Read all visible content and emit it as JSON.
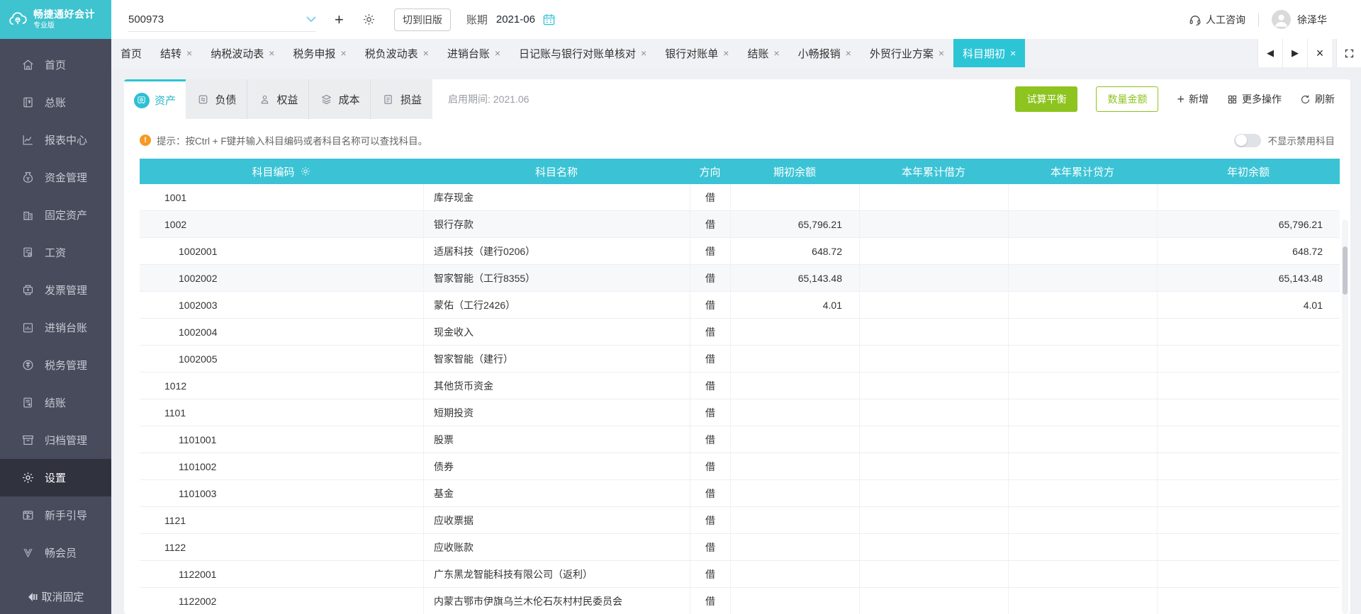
{
  "colors": {
    "brand_teal": "#3ec3cf",
    "active_tab_teal": "#2cc5d6",
    "table_header_teal": "#3bc3d5",
    "action_green": "#8dc41f",
    "sidebar_bg": "#474b5c",
    "sidebar_active_bg": "#30333e",
    "tip_orange": "#f59a23"
  },
  "brand": {
    "name": "畅捷通好会计",
    "edition": "专业版"
  },
  "topbar": {
    "account_number": "500973",
    "switch_old_version": "切到旧版",
    "period_label": "账期",
    "period_value": "2021-06",
    "support_label": "人工咨询",
    "user_name": "徐泽华"
  },
  "tab_strip": {
    "tabs": [
      {
        "label": "首页",
        "closable": false,
        "active": false
      },
      {
        "label": "结转",
        "closable": true,
        "active": false
      },
      {
        "label": "纳税波动表",
        "closable": true,
        "active": false
      },
      {
        "label": "税务申报",
        "closable": true,
        "active": false
      },
      {
        "label": "税负波动表",
        "closable": true,
        "active": false
      },
      {
        "label": "进销台账",
        "closable": true,
        "active": false
      },
      {
        "label": "日记账与银行对账单核对",
        "closable": true,
        "active": false
      },
      {
        "label": "银行对账单",
        "closable": true,
        "active": false
      },
      {
        "label": "结账",
        "closable": true,
        "active": false
      },
      {
        "label": "小畅报销",
        "closable": true,
        "active": false
      },
      {
        "label": "外贸行业方案",
        "closable": true,
        "active": false
      },
      {
        "label": "科目期初",
        "closable": true,
        "active": true
      }
    ]
  },
  "sidebar": {
    "items": [
      {
        "label": "首页",
        "icon": "home-icon",
        "active": false
      },
      {
        "label": "总账",
        "icon": "ledger-icon",
        "active": false
      },
      {
        "label": "报表中心",
        "icon": "report-icon",
        "active": false
      },
      {
        "label": "资金管理",
        "icon": "funds-icon",
        "active": false
      },
      {
        "label": "固定资产",
        "icon": "fixed-asset-icon",
        "active": false
      },
      {
        "label": "工资",
        "icon": "salary-icon",
        "active": false
      },
      {
        "label": "发票管理",
        "icon": "invoice-icon",
        "active": false
      },
      {
        "label": "进销台账",
        "icon": "inventory-icon",
        "active": false
      },
      {
        "label": "税务管理",
        "icon": "tax-icon",
        "active": false
      },
      {
        "label": "结账",
        "icon": "closing-icon",
        "active": false
      },
      {
        "label": "归档管理",
        "icon": "archive-icon",
        "active": false
      },
      {
        "label": "设置",
        "icon": "settings-icon",
        "active": true
      },
      {
        "label": "新手引导",
        "icon": "guide-icon",
        "active": false
      },
      {
        "label": "畅会员",
        "icon": "member-icon",
        "active": false
      }
    ],
    "unpin_label": "取消固定"
  },
  "category_bar": {
    "tabs": [
      {
        "label": "资产",
        "icon": "asset-icon",
        "active": true
      },
      {
        "label": "负债",
        "icon": "liability-icon",
        "active": false
      },
      {
        "label": "权益",
        "icon": "equity-icon",
        "active": false
      },
      {
        "label": "成本",
        "icon": "cost-icon",
        "active": false
      },
      {
        "label": "损益",
        "icon": "profit-loss-icon",
        "active": false
      }
    ],
    "enabled_period": "启用期间: 2021.06",
    "actions": {
      "trial_balance": "试算平衡",
      "quantity_amount": "数量金额",
      "add": "新增",
      "more": "更多操作",
      "refresh": "刷新"
    }
  },
  "tip_bar": {
    "text": "提示：按Ctrl + F键并输入科目编码或者科目名称可以查找科目。",
    "toggle_label": "不显示禁用科目",
    "toggle_on": false
  },
  "table": {
    "columns": [
      "科目编码",
      "科目名称",
      "方向",
      "期初余额",
      "本年累计借方",
      "本年累计贷方",
      "年初余额"
    ],
    "rows": [
      {
        "code": "1001",
        "level": 1,
        "name": "库存现金",
        "direction": "借",
        "opening_balance": "",
        "ytd_debit": "",
        "ytd_credit": "",
        "year_begin_balance": "",
        "shaded": false
      },
      {
        "code": "1002",
        "level": 1,
        "name": "银行存款",
        "direction": "借",
        "opening_balance": "65,796.21",
        "ytd_debit": "",
        "ytd_credit": "",
        "year_begin_balance": "65,796.21",
        "shaded": true
      },
      {
        "code": "1002001",
        "level": 2,
        "name": "适居科技（建行0206）",
        "direction": "借",
        "opening_balance": "648.72",
        "ytd_debit": "",
        "ytd_credit": "",
        "year_begin_balance": "648.72",
        "shaded": false
      },
      {
        "code": "1002002",
        "level": 2,
        "name": "智家智能（工行8355）",
        "direction": "借",
        "opening_balance": "65,143.48",
        "ytd_debit": "",
        "ytd_credit": "",
        "year_begin_balance": "65,143.48",
        "shaded": true
      },
      {
        "code": "1002003",
        "level": 2,
        "name": "蒙佑（工行2426）",
        "direction": "借",
        "opening_balance": "4.01",
        "ytd_debit": "",
        "ytd_credit": "",
        "year_begin_balance": "4.01",
        "shaded": false
      },
      {
        "code": "1002004",
        "level": 2,
        "name": "现金收入",
        "direction": "借",
        "opening_balance": "",
        "ytd_debit": "",
        "ytd_credit": "",
        "year_begin_balance": "",
        "shaded": false
      },
      {
        "code": "1002005",
        "level": 2,
        "name": "智家智能（建行）",
        "direction": "借",
        "opening_balance": "",
        "ytd_debit": "",
        "ytd_credit": "",
        "year_begin_balance": "",
        "shaded": false
      },
      {
        "code": "1012",
        "level": 1,
        "name": "其他货币资金",
        "direction": "借",
        "opening_balance": "",
        "ytd_debit": "",
        "ytd_credit": "",
        "year_begin_balance": "",
        "shaded": false
      },
      {
        "code": "1101",
        "level": 1,
        "name": "短期投资",
        "direction": "借",
        "opening_balance": "",
        "ytd_debit": "",
        "ytd_credit": "",
        "year_begin_balance": "",
        "shaded": false
      },
      {
        "code": "1101001",
        "level": 2,
        "name": "股票",
        "direction": "借",
        "opening_balance": "",
        "ytd_debit": "",
        "ytd_credit": "",
        "year_begin_balance": "",
        "shaded": false
      },
      {
        "code": "1101002",
        "level": 2,
        "name": "债券",
        "direction": "借",
        "opening_balance": "",
        "ytd_debit": "",
        "ytd_credit": "",
        "year_begin_balance": "",
        "shaded": false
      },
      {
        "code": "1101003",
        "level": 2,
        "name": "基金",
        "direction": "借",
        "opening_balance": "",
        "ytd_debit": "",
        "ytd_credit": "",
        "year_begin_balance": "",
        "shaded": false
      },
      {
        "code": "1121",
        "level": 1,
        "name": "应收票据",
        "direction": "借",
        "opening_balance": "",
        "ytd_debit": "",
        "ytd_credit": "",
        "year_begin_balance": "",
        "shaded": false
      },
      {
        "code": "1122",
        "level": 1,
        "name": "应收账款",
        "direction": "借",
        "opening_balance": "",
        "ytd_debit": "",
        "ytd_credit": "",
        "year_begin_balance": "",
        "shaded": false
      },
      {
        "code": "1122001",
        "level": 2,
        "name": "广东黑龙智能科技有限公司（返利）",
        "direction": "借",
        "opening_balance": "",
        "ytd_debit": "",
        "ytd_credit": "",
        "year_begin_balance": "",
        "shaded": false
      },
      {
        "code": "1122002",
        "level": 2,
        "name": "内蒙古鄂市伊旗乌兰木伦石灰村村民委员会",
        "direction": "借",
        "opening_balance": "",
        "ytd_debit": "",
        "ytd_credit": "",
        "year_begin_balance": "",
        "shaded": false
      }
    ]
  }
}
